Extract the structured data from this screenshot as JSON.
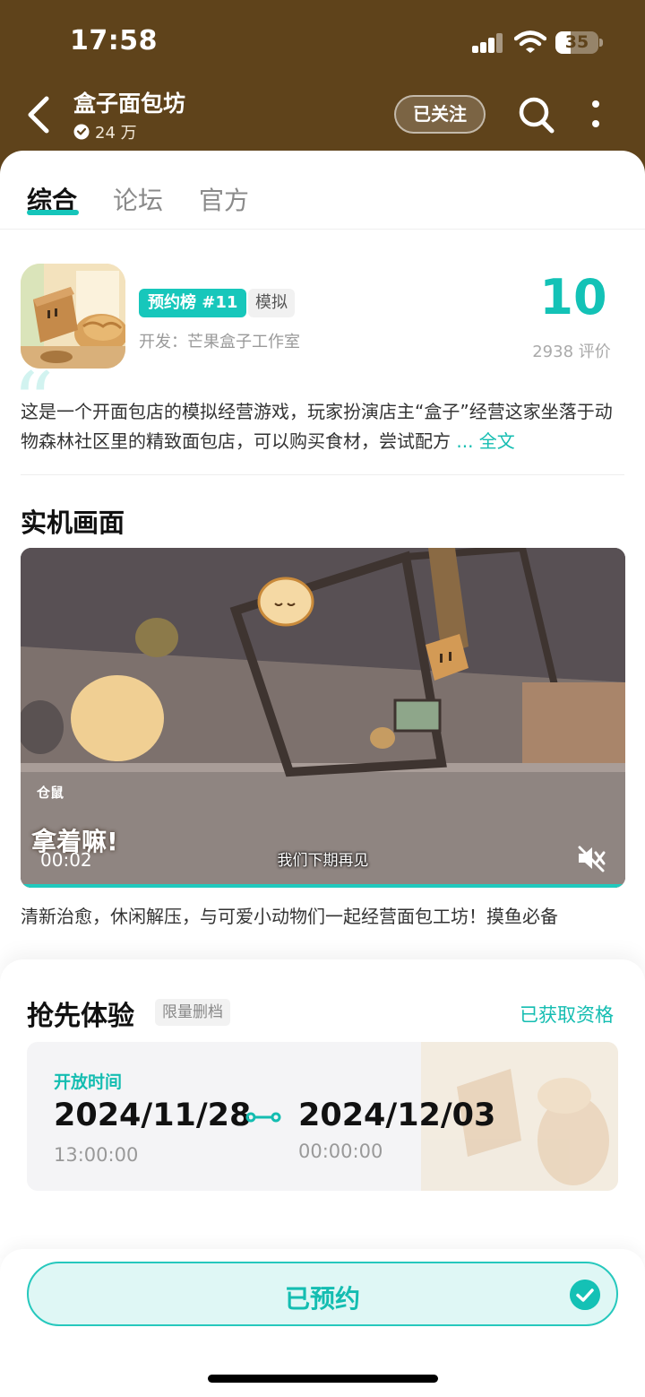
{
  "status_bar": {
    "time": "17:58",
    "battery": "35",
    "battery_level": 0.35,
    "signal_bars": 3
  },
  "header": {
    "title": "盒子面包坊",
    "followers": "24 万",
    "follow_label": "已关注",
    "bg_color": "#5f431b"
  },
  "tabs": [
    {
      "label": "综合",
      "active": true
    },
    {
      "label": "论坛",
      "active": false
    },
    {
      "label": "官方",
      "active": false
    }
  ],
  "game": {
    "rank_badge": "预约榜 #11",
    "genre": "模拟",
    "developer": "开发：芒果盒子工作室",
    "score": "10",
    "score_count": "2938 评价",
    "description": "这是一个开面包店的模拟经营游戏，玩家扮演店主“盒子”经营这家坐落于动物森林社区里的精致面包店，可以购买食材，尝试配方",
    "more_label": "... 全文"
  },
  "screenshots": {
    "title": "实机画面",
    "video": {
      "time": "00:02",
      "subtitle": "我们下期再见",
      "caption": "拿着嘛!",
      "tag": "仓鼠",
      "progress": 0.01
    },
    "note": "清新治愈，休闲解压，与可爱小动物们一起经营面包工坊！摸鱼必备"
  },
  "early_access": {
    "title": "抢先体验",
    "tag": "限量删档",
    "status": "已获取资格",
    "open_label": "开放时间",
    "start_date": "2024/11/28",
    "start_time": "13:00:00",
    "end_date": "2024/12/03",
    "end_time": "00:00:00"
  },
  "bottom": {
    "reserve_label": "已预约"
  },
  "colors": {
    "accent": "#14bdb1",
    "header_bg": "#5f431b"
  },
  "icons": {
    "back": "chevron-left-icon",
    "search": "search-icon",
    "more": "more-vertical-icon",
    "mute": "volume-mute-icon",
    "check": "check-circle-icon",
    "verified": "heart-shield-icon"
  }
}
